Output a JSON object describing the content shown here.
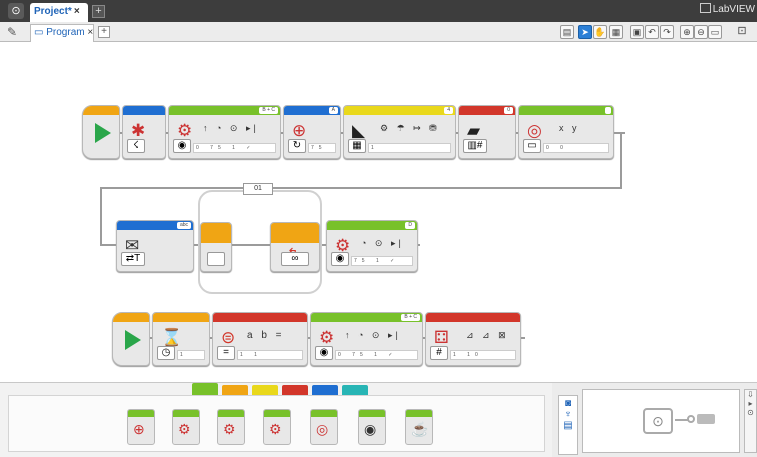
{
  "app": {
    "title": "LabVIEW"
  },
  "project_tab": {
    "label": "Project",
    "modified": "*",
    "close": "×",
    "add": "+"
  },
  "program_tab": {
    "label": "Program",
    "close": "×",
    "add": "+"
  },
  "toolbar": {
    "items": [
      "page-icon",
      "select-icon",
      "pan-icon",
      "comment-icon",
      "save-icon",
      "undo-icon",
      "redo-icon",
      "zoom-in-icon",
      "zoom-out-icon",
      "zoom-reset-icon"
    ]
  },
  "program": {
    "row1": {
      "blocks": [
        {
          "type": "start",
          "color": "#f0a514"
        },
        {
          "type": "brick-bluetooth",
          "color": "#1f6ed1",
          "port": ""
        },
        {
          "type": "move-tank",
          "color": "#78c12a",
          "port": "B + C",
          "params": "↑ ◔ ⊙ ▸|",
          "values": "0 75 1 ✓"
        },
        {
          "type": "medium-motor",
          "color": "#1f6ed1",
          "port": "A",
          "values": "75"
        },
        {
          "type": "sound",
          "color": "#e9d81b",
          "port": "4",
          "values": "1"
        },
        {
          "type": "data-logging",
          "color": "#d2362a",
          "port": "0"
        },
        {
          "type": "math",
          "color": "#78c12a",
          "port": "",
          "params": "x y",
          "values": "0 0"
        }
      ]
    },
    "row2": {
      "loop_label": "01",
      "blocks": [
        {
          "type": "messaging",
          "color": "#1f6ed1",
          "port": "abc"
        },
        {
          "type": "loop-start",
          "color": "#f0a514"
        },
        {
          "type": "loop-end",
          "color": "#f0a514",
          "mode": "∞"
        },
        {
          "type": "large-motor",
          "color": "#78c12a",
          "port": "D",
          "values": "75 1 ✓"
        }
      ]
    },
    "row3": {
      "blocks": [
        {
          "type": "start",
          "color": "#f0a514"
        },
        {
          "type": "wait-timer",
          "color": "#f0a514",
          "values": "1"
        },
        {
          "type": "compare",
          "color": "#d2362a",
          "params": "a b =",
          "values": "1 1"
        },
        {
          "type": "move-steering",
          "color": "#78c12a",
          "port": "B + C",
          "values": "0 75 1 ✓"
        },
        {
          "type": "random",
          "color": "#d2362a",
          "values": "1 10"
        }
      ]
    }
  },
  "palette": {
    "tabs": [
      "#78c12a",
      "#f0a514",
      "#e9d81b",
      "#d2362a",
      "#1f6ed1",
      "#28b5b5"
    ],
    "blocks": [
      "medium-motor",
      "large-motor",
      "move-steering",
      "move-tank",
      "display",
      "sound",
      "brick-status-light"
    ]
  },
  "hardware": {
    "panel": "brick-port-view"
  }
}
